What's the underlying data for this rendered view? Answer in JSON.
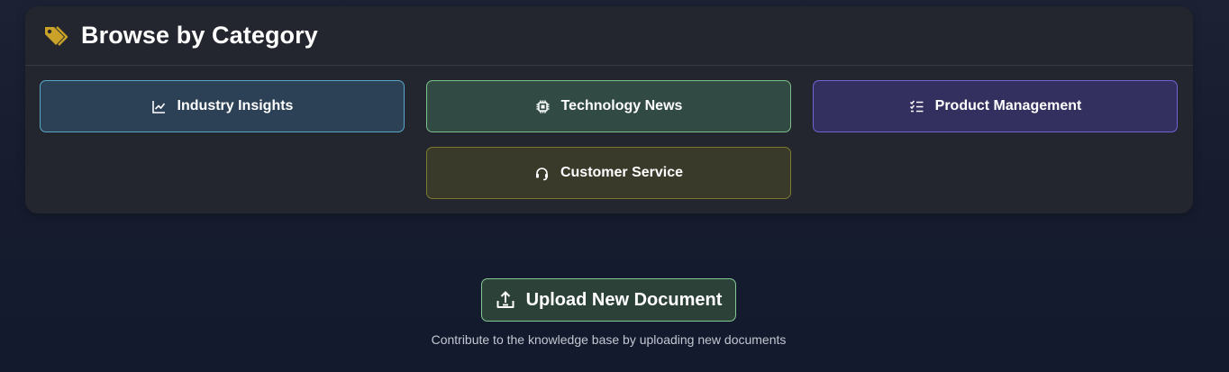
{
  "browse": {
    "title": "Browse by Category",
    "icon": "tag-icon",
    "icon_color": "#c9a227",
    "categories": [
      {
        "label": "Industry Insights",
        "icon": "chart-line-icon",
        "bg": "#2c4156",
        "border": "#5aa8c8"
      },
      {
        "label": "Technology News",
        "icon": "chip-icon",
        "bg": "#314a44",
        "border": "#7dbf88"
      },
      {
        "label": "Product Management",
        "icon": "checklist-icon",
        "bg": "#332f5e",
        "border": "#6d64d6"
      },
      {
        "label": "Customer Service",
        "icon": "headset-icon",
        "bg": "#3a3a2b",
        "border": "#7b7a2e"
      }
    ]
  },
  "upload": {
    "label": "Upload New Document",
    "icon": "upload-icon",
    "hint": "Contribute to the knowledge base by uploading new documents"
  }
}
